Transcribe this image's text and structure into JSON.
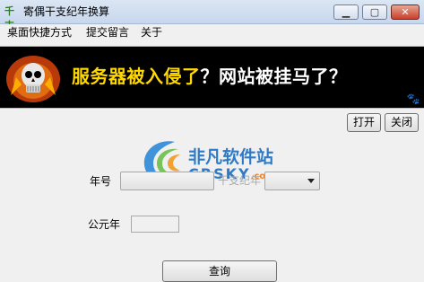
{
  "window": {
    "title": "寄偶干支纪年换算",
    "icon_text": "千支",
    "controls": [
      "minimize-icon",
      "maximize-icon",
      "close-icon"
    ]
  },
  "menu": {
    "items": [
      "桌面快捷方式",
      "提交留言",
      "关于"
    ]
  },
  "banner": {
    "text_part1": "服务器被入侵了",
    "q1": "？",
    "text_part2": "网站被挂马了",
    "q2": "？"
  },
  "buttons": {
    "open": "打开",
    "close": "关闭",
    "query": "查询"
  },
  "form": {
    "year_label": "年号",
    "ganzhi_label": "干支纪年",
    "ad_label": "公元年",
    "year_value": "",
    "ganzhi_value": "",
    "ad_value": ""
  },
  "watermark": {
    "cn": "非凡软件站",
    "en": "CRSKY",
    "suffix": ".com"
  },
  "colors": {
    "banner_yellow": "#ffd800",
    "watermark_blue": "#1a6ec2",
    "watermark_orange": "#e87a1b"
  }
}
